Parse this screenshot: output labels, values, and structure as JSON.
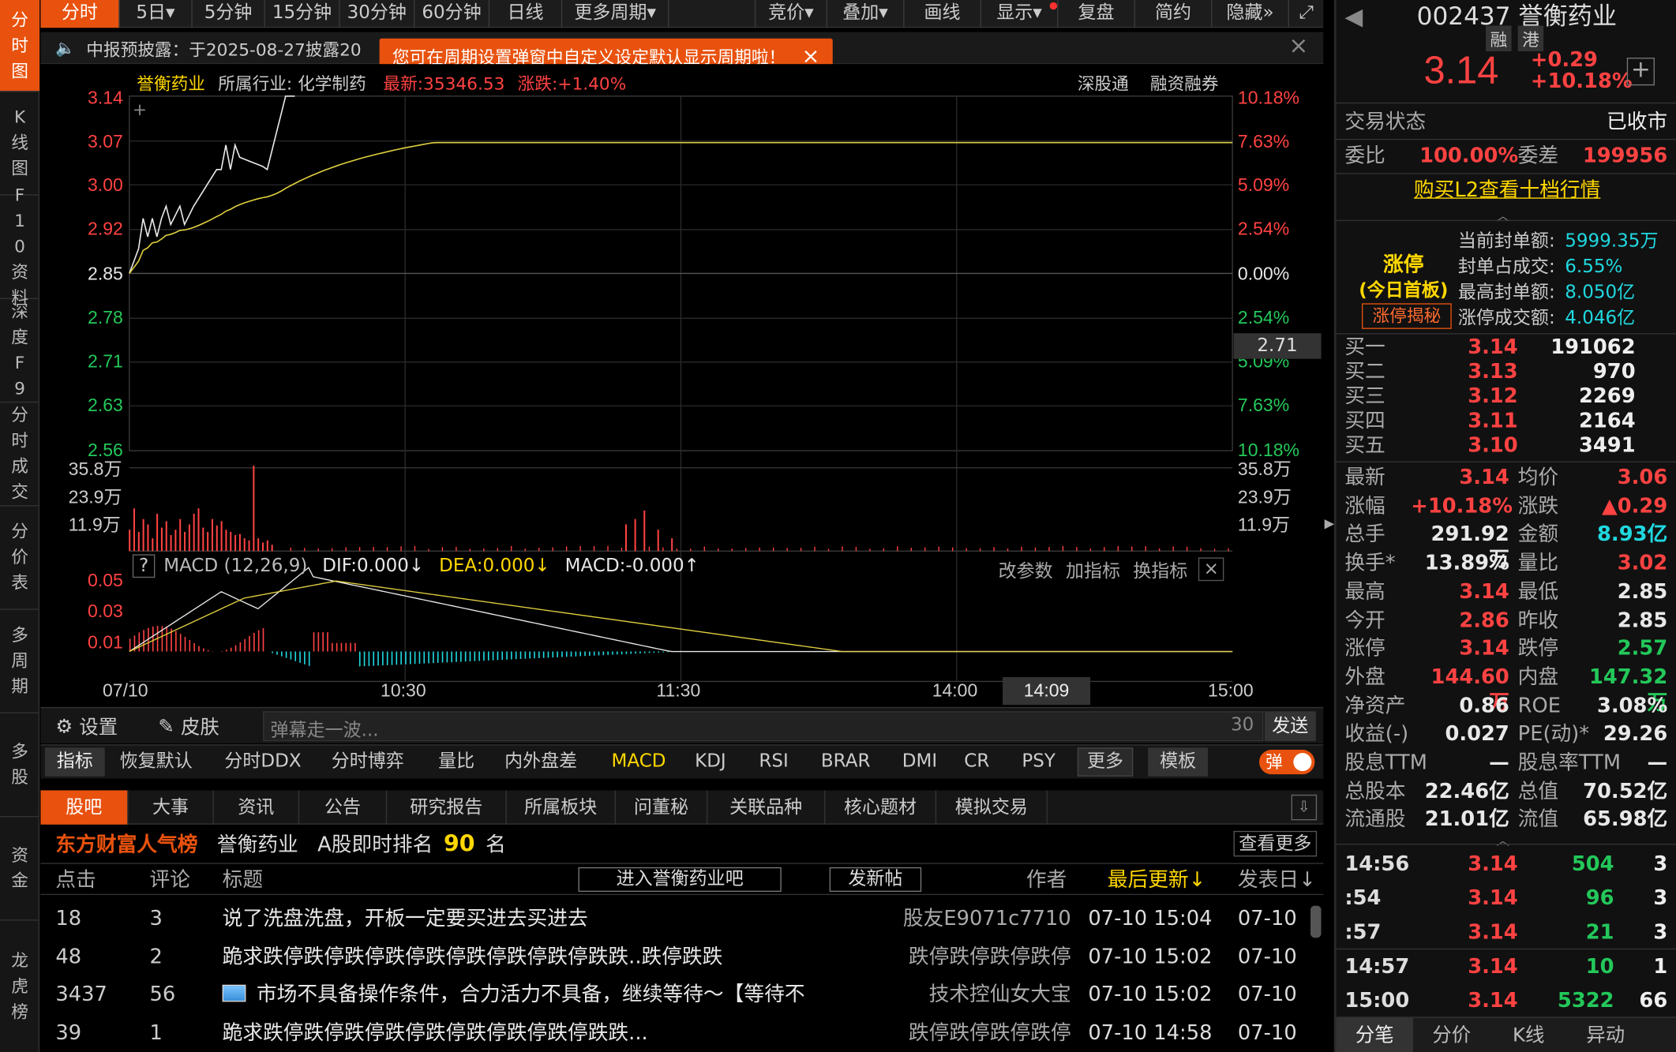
{
  "left_nav": [
    {
      "label": "分时图",
      "active": true
    },
    {
      "label": "K线图"
    },
    {
      "label": "F10资料"
    },
    {
      "label": "深度F9"
    },
    {
      "label": "分时成交"
    },
    {
      "label": "分价表"
    },
    {
      "label": "多周期"
    },
    {
      "label": "多股"
    },
    {
      "label": "资金"
    },
    {
      "label": "龙虎榜"
    }
  ],
  "toolbar": {
    "tabs": [
      "分时",
      "5日▾",
      "5分钟",
      "15分钟",
      "30分钟",
      "60分钟",
      "日线",
      "更多周期▾"
    ],
    "right": [
      "竞价▾",
      "叠加▾",
      "画线",
      "显示▾",
      "复盘",
      "简约",
      "隐藏»",
      "⤢"
    ]
  },
  "notice": {
    "text": "中报预披露：于2025-08-27披露20",
    "tooltip": "您可在周期设置弹窗中自定义设定默认显示周期啦！"
  },
  "stock_header": {
    "name": "誉衡药业",
    "industry": "所属行业: 化学制药",
    "latest": "最新:35346.53",
    "change": "涨跌:+1.40%",
    "links": [
      "深股通",
      "融资融券"
    ]
  },
  "chart": {
    "price_axis": {
      "left": [
        {
          "t": "3.14",
          "c": "red"
        },
        {
          "t": "3.07",
          "c": "red"
        },
        {
          "t": "3.00",
          "c": "red"
        },
        {
          "t": "2.92",
          "c": "red"
        },
        {
          "t": "2.85",
          "c": "white"
        },
        {
          "t": "2.78",
          "c": "green"
        },
        {
          "t": "2.71",
          "c": "green"
        },
        {
          "t": "2.63",
          "c": "green"
        },
        {
          "t": "2.56",
          "c": "green"
        }
      ],
      "right": [
        {
          "t": "10.18%",
          "c": "red"
        },
        {
          "t": "7.63%",
          "c": "red"
        },
        {
          "t": "5.09%",
          "c": "red"
        },
        {
          "t": "2.54%",
          "c": "red"
        },
        {
          "t": "0.00%",
          "c": "white"
        },
        {
          "t": "2.54%",
          "c": "green"
        },
        {
          "t": "5.09%",
          "c": "green"
        },
        {
          "t": "7.63%",
          "c": "green"
        },
        {
          "t": "10.18%",
          "c": "green"
        }
      ]
    },
    "cursor_price": "2.71",
    "vol_axis": [
      "35.8万",
      "23.9万",
      "11.9万"
    ],
    "macd_header": {
      "q": "?",
      "name": "MACD (12,26,9)",
      "dif": "DIF:0.000↓",
      "dea": "DEA:0.000↓",
      "macd": "MACD:-0.000↑",
      "actions": [
        "改参数",
        "加指标",
        "换指标"
      ]
    },
    "macd_axis": [
      "0.05",
      "0.03",
      "0.01"
    ],
    "time_axis": [
      "07/10",
      "10:30",
      "11:30",
      "14:00",
      "14:09",
      "15:00"
    ]
  },
  "danmu": {
    "settings": "设置",
    "skin": "皮肤",
    "placeholder": "弹幕走一波...",
    "count": "30",
    "send": "发送"
  },
  "indicators": {
    "label": "指标",
    "items": [
      "恢复默认",
      "分时DDX",
      "分时博弈",
      "量比",
      "内外盘差",
      "MACD",
      "KDJ",
      "RSI",
      "BRAR",
      "DMI",
      "CR",
      "PSY"
    ],
    "more": "更多",
    "template": "模板",
    "toggle": "弹"
  },
  "forum": {
    "tabs": [
      "股吧",
      "大事",
      "资讯",
      "公告",
      "研究报告",
      "所属板块",
      "问董秘",
      "关联品种",
      "核心题材",
      "模拟交易"
    ],
    "rank": {
      "title": "东方财富人气榜",
      "name": "誉衡药业",
      "label": "A股即时排名",
      "num": "90",
      "unit": "名",
      "more": "查看更多"
    },
    "cols": {
      "clicks": "点击",
      "comments": "评论",
      "title": "标题",
      "enter": "进入誉衡药业吧",
      "post": "发新帖",
      "author": "作者",
      "updated": "最后更新↓",
      "date": "发表日↓"
    },
    "rows": [
      {
        "clicks": "18",
        "comments": "3",
        "title": "说了洗盘洗盘，开板一定要买进去买进去",
        "author": "股友E9071c7710",
        "updated": "07-10 15:04",
        "date": "07-10",
        "img": false
      },
      {
        "clicks": "48",
        "comments": "2",
        "title": "跪求跌停跌停跌停跌停跌停跌停跌停跌停跌跌..跌停跌跌",
        "author": "跌停跌停跌停跌停",
        "updated": "07-10 15:02",
        "date": "07-10",
        "img": false
      },
      {
        "clicks": "3437",
        "comments": "56",
        "title": "市场不具备操作条件，合力活力不具备，继续等待～【等待不",
        "author": "技术控仙女大宝",
        "updated": "07-10 15:02",
        "date": "07-10",
        "img": true
      },
      {
        "clicks": "39",
        "comments": "1",
        "title": "跪求跌停跌停跌停跌停跌停跌停跌停跌停跌跌...",
        "author": "跌停跌停跌停跌停",
        "updated": "07-10 14:58",
        "date": "07-10",
        "img": false
      }
    ]
  },
  "right": {
    "code": "002437 誉衡药业",
    "tags": [
      "融",
      "港"
    ],
    "price": "3.14",
    "chg": "+0.29",
    "pct": "+10.18%",
    "status_label": "交易状态",
    "status": "已收市",
    "wb_label": "委比",
    "wb": "100.00%",
    "wc_label": "委差",
    "wc": "199956",
    "l2": "购买L2查看十档行情",
    "limit": {
      "title": "涨停",
      "sub": "(今日首板)",
      "btn": "涨停揭秘",
      "rows": [
        {
          "k": "当前封单额:",
          "v": "5999.35万"
        },
        {
          "k": "封单占成交:",
          "v": "6.55%"
        },
        {
          "k": "最高封单额:",
          "v": "8.050亿"
        },
        {
          "k": "涨停成交额:",
          "v": "4.046亿"
        }
      ]
    },
    "bids": [
      {
        "k": "买一",
        "p": "3.14",
        "v": "191062"
      },
      {
        "k": "买二",
        "p": "3.13",
        "v": "970"
      },
      {
        "k": "买三",
        "p": "3.12",
        "v": "2269"
      },
      {
        "k": "买四",
        "p": "3.11",
        "v": "2164"
      },
      {
        "k": "买五",
        "p": "3.10",
        "v": "3491"
      }
    ],
    "stats": [
      {
        "k1": "最新",
        "v1": "3.14",
        "c1": "red",
        "k2": "均价",
        "v2": "3.06",
        "c2": "red"
      },
      {
        "k1": "涨幅",
        "v1": "+10.18%",
        "c1": "red",
        "k2": "涨跌",
        "v2": "▲0.29",
        "c2": "red"
      },
      {
        "k1": "总手",
        "v1": "291.92万",
        "c1": "white",
        "k2": "金额",
        "v2": "8.93亿",
        "c2": "cyan"
      },
      {
        "k1": "换手*",
        "v1": "13.89%",
        "c1": "white",
        "k2": "量比",
        "v2": "3.02",
        "c2": "red"
      },
      {
        "k1": "最高",
        "v1": "3.14",
        "c1": "red",
        "k2": "最低",
        "v2": "2.85",
        "c2": "white"
      },
      {
        "k1": "今开",
        "v1": "2.86",
        "c1": "red",
        "k2": "昨收",
        "v2": "2.85",
        "c2": "white"
      },
      {
        "k1": "涨停",
        "v1": "3.14",
        "c1": "red",
        "k2": "跌停",
        "v2": "2.57",
        "c2": "green"
      },
      {
        "k1": "外盘",
        "v1": "144.60万",
        "c1": "red",
        "k2": "内盘",
        "v2": "147.32万",
        "c2": "green"
      },
      {
        "k1": "净资产",
        "v1": "0.86",
        "c1": "white",
        "k2": "ROE",
        "v2": "3.08%",
        "c2": "white"
      },
      {
        "k1": "收益(-)",
        "v1": "0.027",
        "c1": "white",
        "k2": "PE(动)*",
        "v2": "29.26",
        "c2": "white"
      },
      {
        "k1": "股息TTM",
        "v1": "—",
        "c1": "white",
        "k2": "股息率TTM",
        "v2": "—",
        "c2": "white"
      },
      {
        "k1": "总股本",
        "v1": "22.46亿",
        "c1": "white",
        "k2": "总值",
        "v2": "70.52亿",
        "c2": "white"
      },
      {
        "k1": "流通股",
        "v1": "21.01亿",
        "c1": "white",
        "k2": "流值",
        "v2": "65.98亿",
        "c2": "white"
      }
    ],
    "ticks": [
      {
        "t": "14:56",
        "p": "3.14",
        "v": "504",
        "n": "3",
        "vc": "green"
      },
      {
        "t": ":54",
        "p": "3.14",
        "v": "96",
        "n": "3",
        "vc": "green"
      },
      {
        "t": ":57",
        "p": "3.14",
        "v": "21",
        "n": "3",
        "vc": "green"
      },
      {
        "t": "14:57",
        "p": "3.14",
        "v": "10",
        "n": "1",
        "vc": "green"
      },
      {
        "t": "15:00",
        "p": "3.14",
        "v": "5322",
        "n": "66",
        "vc": "green"
      }
    ],
    "bottom_tabs": [
      "分笔",
      "分价",
      "K线",
      "异动"
    ]
  }
}
